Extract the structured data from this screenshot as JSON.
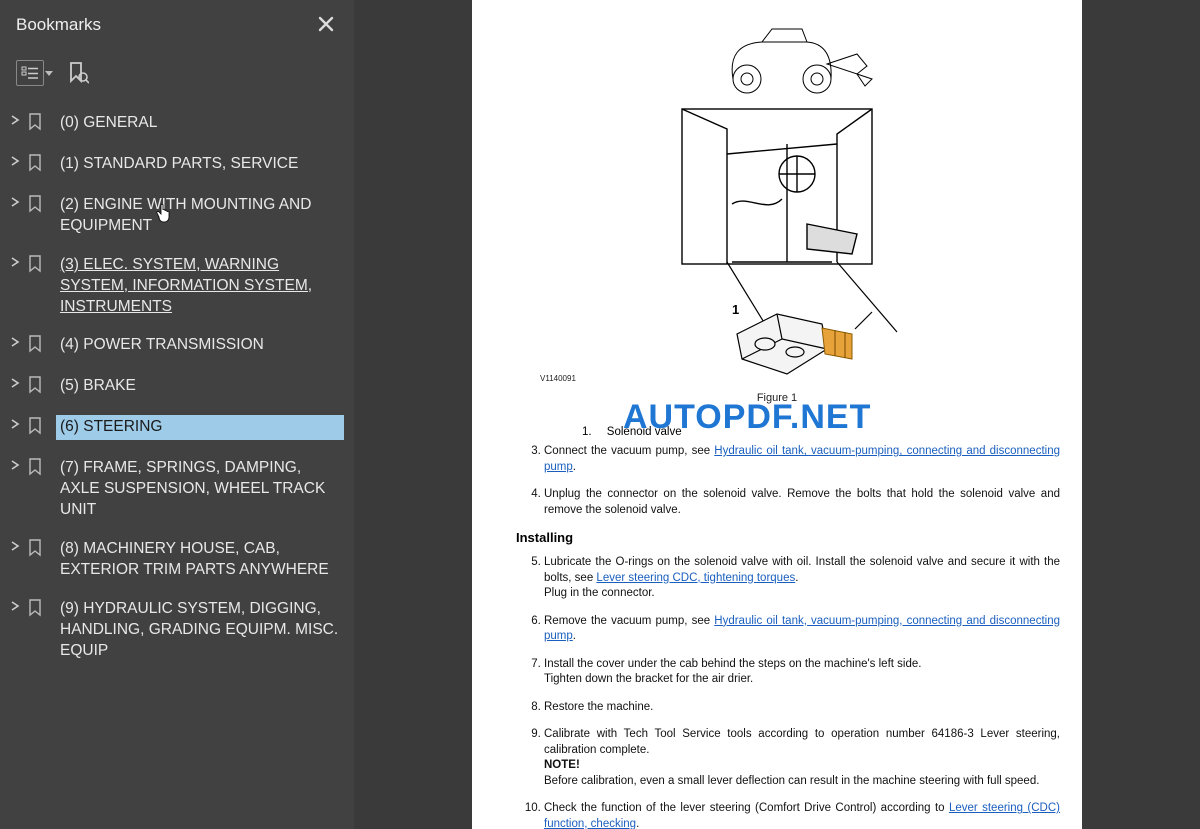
{
  "sidebar": {
    "title": "Bookmarks",
    "items": [
      {
        "label": "(0) GENERAL"
      },
      {
        "label": "(1) STANDARD PARTS, SERVICE"
      },
      {
        "label": "(2) ENGINE WITH MOUNTING AND EQUIPMENT"
      },
      {
        "label": "(3) ELEC. SYSTEM, WARNING SYSTEM, INFORMATION SYSTEM, INSTRUMENTS"
      },
      {
        "label": "(4) POWER TRANSMISSION"
      },
      {
        "label": "(5) BRAKE"
      },
      {
        "label": "(6) STEERING"
      },
      {
        "label": "(7) FRAME, SPRINGS, DAMPING, AXLE SUSPENSION, WHEEL TRACK UNIT"
      },
      {
        "label": "(8) MACHINERY HOUSE, CAB, EXTERIOR TRIM PARTS ANYWHERE"
      },
      {
        "label": "(9) HYDRAULIC SYSTEM, DIGGING, HANDLING, GRADING EQUIPM. MISC. EQUIP"
      }
    ]
  },
  "document": {
    "watermark": "AUTOPDF.NET",
    "figure_label": "Figure 1",
    "diagram_ref": "V1140091",
    "diagram_callout": "1",
    "legend": {
      "num": "1.",
      "text": "Solenoid valve"
    },
    "section_install": "Installing",
    "steps": {
      "s3a": "Connect the vacuum pump, see ",
      "s3link": "Hydraulic oil tank, vacuum-pumping, connecting and disconnecting pump",
      "s3b": ".",
      "s4": "Unplug the connector on the solenoid valve. Remove the bolts that hold the solenoid valve and remove the solenoid valve.",
      "s5a": "Lubricate the O-rings on the solenoid valve with oil. Install the solenoid valve and secure it with the bolts, see ",
      "s5link": "Lever steering CDC, tightening torques",
      "s5b": ".",
      "s5c": "Plug in the connector.",
      "s6a": "Remove the vacuum pump, see ",
      "s6link": "Hydraulic oil tank, vacuum-pumping, connecting and disconnecting pump",
      "s6b": ".",
      "s7a": "Install the cover under the cab behind the steps on the machine's left side.",
      "s7b": "Tighten down the bracket for the air drier.",
      "s8": "Restore the machine.",
      "s9a": "Calibrate with Tech Tool Service tools according to operation number 64186-3 Lever steering, calibration complete.",
      "s9note": "NOTE!",
      "s9b": "Before calibration, even a small lever deflection can result in the machine steering with full speed.",
      "s10a": "Check the function of the lever steering (Comfort Drive Control) according to ",
      "s10link": "Lever steering (CDC) function, checking",
      "s10b": "."
    }
  }
}
